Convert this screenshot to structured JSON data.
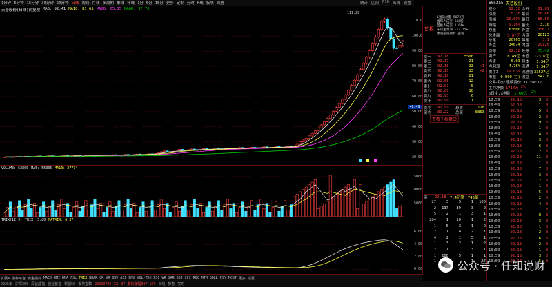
{
  "toolbar": {
    "items": [
      "1分钟",
      "5分钟",
      "15分钟",
      "30分钟",
      "60分钟",
      "日线",
      "周线",
      "月线",
      "多周期",
      "季线",
      "年线",
      "1分",
      "5分",
      "15分",
      "更多",
      "定制",
      "分时",
      "K线",
      "板块",
      "自选"
    ],
    "active_index": 5,
    "icons": [
      "统计",
      "区间",
      "F10",
      "画线",
      "设置"
    ]
  },
  "ma_header": {
    "prefix": "天普股份(日线)前复权",
    "ma5": "MA5: 92.41",
    "ma10": "MA10: 81.61",
    "ma20": "MA20: 65.15",
    "ma60": "MA60: 37.76"
  },
  "kline": {
    "axis": [
      "110.0",
      "100.0",
      "90.00",
      "80.00",
      "70.00",
      "60.00",
      "50.00",
      "40.00",
      "30.00",
      "20.00"
    ],
    "peak_label": "111.29",
    "low_label": "19.82",
    "current_tag": "48.49"
  },
  "chart_data": {
    "type": "line",
    "closes": [
      20.1,
      20.3,
      20.0,
      20.2,
      20.5,
      20.4,
      20.3,
      20.6,
      20.4,
      20.2,
      20.5,
      20.8,
      20.6,
      20.4,
      20.7,
      20.9,
      20.6,
      20.4,
      20.5,
      20.8,
      21.0,
      20.7,
      20.6,
      20.9,
      21.1,
      20.8,
      20.6,
      20.9,
      21.2,
      21.0,
      20.8,
      21.1,
      21.4,
      21.2,
      21.0,
      21.3,
      21.6,
      21.4,
      21.1,
      21.5,
      21.8,
      21.5,
      21.3,
      21.7,
      22.0,
      21.7,
      21.5,
      21.9,
      22.2,
      21.9,
      22.3,
      22.8,
      23.5,
      24.0,
      23.6,
      23.2,
      23.8,
      24.5,
      25.1,
      24.6,
      24.2,
      24.8,
      25.3,
      24.9,
      24.5,
      25.0,
      25.6,
      25.2,
      24.8,
      25.3,
      25.9,
      25.5,
      25.1,
      25.6,
      26.0,
      25.7,
      25.3,
      25.8,
      26.3,
      26.0,
      25.6,
      26.1,
      26.5,
      26.2,
      25.8,
      26.3,
      26.8,
      26.4,
      26.0,
      26.5,
      27.0,
      26.6,
      26.2,
      26.7,
      27.2,
      26.8,
      27.3,
      28.5,
      30.1,
      31.2,
      32.5,
      34.0,
      35.6,
      37.4,
      39.3,
      41.3,
      43.4,
      45.6,
      47.9,
      50.3,
      52.8,
      55.4,
      58.2,
      61.1,
      64.2,
      67.4,
      70.8,
      74.3,
      78.0,
      81.9,
      86.0,
      90.3,
      94.8,
      99.5,
      104.5,
      109.7,
      111.0,
      105.2,
      98.0,
      92.2,
      92.18,
      94.0,
      96.5
    ],
    "volume_axis": [
      "15000",
      "10000",
      "5000"
    ],
    "volume_header": {
      "title": "VOLUME: 63800",
      "ma5": "MA5: 55305",
      "ma10": "MA10: 37714"
    },
    "trix_header": {
      "title": "TRIX(12,9)",
      "trix": "TRIX: 5.80",
      "matrix": "MATRIX: 6.37"
    },
    "trix_axis": [
      "6.00",
      "4.00",
      "2.00",
      "0.00"
    ]
  },
  "quote": {
    "code": "605255",
    "name": "天普股份",
    "rows": [
      {
        "l": "现价",
        "lv": "92.18",
        "r": "今开",
        "rv": "91.81"
      },
      {
        "l": "涨跌",
        "lv": "8.38",
        "r": "最高",
        "rv": "96.46"
      },
      {
        "l": "涨幅",
        "lv": "10.00%",
        "r": "最低",
        "rv": "88.50"
      },
      {
        "l": "振幅",
        "lv": "9.16%",
        "r": "量比",
        "rv": "3.10"
      },
      {
        "l": "总量",
        "lv": "63800",
        "r": "外盘",
        "rv": "35677"
      },
      {
        "l": "总金额",
        "lv": "5.87亿",
        "r": "内盘",
        "rv": "28123"
      },
      {
        "l": "总笔",
        "lv": "20765",
        "r": "每笔",
        "rv": "3.1"
      },
      {
        "l": "外盘",
        "lv": "34674",
        "r": "内盘",
        "rv": "29126"
      },
      {
        "l": "涨停",
        "lv": "92.18",
        "r": "跌停",
        "rv": "75.42"
      },
      {
        "l": "资产",
        "lv": "8.49亿",
        "r": "市值",
        "rv": "123.6亿"
      },
      {
        "l": "净资",
        "lv": "6.03",
        "r": "股本",
        "rv": "1.34亿"
      },
      {
        "l": "净利润",
        "lv": "4.76%",
        "r": "流通",
        "rv": "1.34亿"
      },
      {
        "l": "换手Z",
        "lv": "19.03%",
        "r": "流通值",
        "rv": "33527亿"
      },
      {
        "l": "市盈",
        "lv": "0.000(亏)",
        "r": "收益",
        "rv": "547.0"
      }
    ],
    "status_line": "交易状态:连续竞价 11:04:12",
    "flow1": {
      "label": "主力净额",
      "v1": "1714万",
      "v2": "2%"
    },
    "flow2": {
      "label": "5日主力净额",
      "v1": "-1.60亿",
      "v2": "-2%"
    },
    "trades": [
      {
        "t": "10:59",
        "p": "92.18",
        "v": "3",
        "d": "B"
      },
      {
        "t": "10:59",
        "p": "92.18",
        "v": "1",
        "d": "B"
      },
      {
        "t": "10:59",
        "p": "92.18",
        "v": "5",
        "d": "B"
      },
      {
        "t": "10:59",
        "p": "92.18",
        "v": "2",
        "d": "B"
      },
      {
        "t": "10:59",
        "p": "92.18",
        "v": "9",
        "d": "B"
      },
      {
        "t": "10:59",
        "p": "92.18",
        "v": "1",
        "d": "B"
      },
      {
        "t": "10:59",
        "p": "92.18",
        "v": "4",
        "d": "B"
      },
      {
        "t": "10:59",
        "p": "92.18",
        "v": "3",
        "d": "B"
      },
      {
        "t": "10:59",
        "p": "92.18",
        "v": "6",
        "d": "B"
      },
      {
        "t": "10:59",
        "p": "92.18",
        "v": "2",
        "d": "B"
      },
      {
        "t": "10:59",
        "p": "92.18",
        "v": "11",
        "d": "B"
      },
      {
        "t": "10:59",
        "p": "92.18",
        "v": "1",
        "d": "B"
      },
      {
        "t": "10:59",
        "p": "92.18",
        "v": "7",
        "d": "B"
      },
      {
        "t": "10:59",
        "p": "92.18",
        "v": "3",
        "d": "B"
      },
      {
        "t": "10:59",
        "p": "92.18",
        "v": "2",
        "d": "B"
      },
      {
        "t": "10:59",
        "p": "92.18",
        "v": "1",
        "d": "B"
      },
      {
        "t": "10:59",
        "p": "92.18",
        "v": "5",
        "d": "B"
      },
      {
        "t": "10:59",
        "p": "92.18",
        "v": "2",
        "d": "B"
      },
      {
        "t": "10:59",
        "p": "92.18",
        "v": "4",
        "d": "B"
      },
      {
        "t": "10:59",
        "p": "92.18",
        "v": "1",
        "d": "B"
      },
      {
        "t": "10:59",
        "p": "92.18",
        "v": "8",
        "d": "B"
      },
      {
        "t": "10:59",
        "p": "92.18",
        "v": "3",
        "d": "B"
      },
      {
        "t": "10:59",
        "p": "92.18",
        "v": "1",
        "d": "B"
      },
      {
        "t": "10:59",
        "p": "92.18",
        "v": "2",
        "d": "B"
      },
      {
        "t": "10:59",
        "p": "92.18",
        "v": "6",
        "d": "B"
      },
      {
        "t": "10:59",
        "p": "92.18",
        "v": "2",
        "d": "B"
      },
      {
        "t": "10:59",
        "p": "92.18",
        "v": "1",
        "d": "B"
      },
      {
        "t": "10:59",
        "p": "92.18",
        "v": "3",
        "d": "B"
      },
      {
        "t": "10:59",
        "p": "92.18",
        "v": "5",
        "d": "B"
      }
    ]
  },
  "mid": {
    "tag": "首板",
    "stats": [
      "1当前总量 5073万",
      "当年人成交 606股",
      "首板人成交 1.64%",
      "十日主力净 -17.15%",
      "建设投资题材 查看"
    ],
    "orders": [
      {
        "l": "卖一",
        "p": "92.18",
        "v": "5506",
        "c": ""
      },
      {
        "l": "卖二",
        "p": "92.17",
        "v": "21",
        "c": "+"
      },
      {
        "l": "卖三",
        "p": "92.16",
        "v": "13",
        "c": "+1"
      },
      {
        "l": "卖四",
        "p": "92.15",
        "v": "13",
        "c": "+2"
      },
      {
        "l": "卖五",
        "p": "92.10",
        "v": "21",
        "c": ""
      },
      {
        "l": "卖六",
        "p": "92.05",
        "v": "12",
        "c": ""
      },
      {
        "l": "卖七",
        "p": "92.01",
        "v": "5",
        "c": ""
      },
      {
        "l": "卖八",
        "p": "92.00",
        "v": "10",
        "c": ""
      },
      {
        "l": "卖九",
        "p": "91.93",
        "v": "6",
        "c": ""
      },
      {
        "l": "卖十",
        "p": "91.90",
        "v": "1",
        "c": ""
      }
    ],
    "sum1": {
      "l": "卖均",
      "v": "91.99",
      "r": "总卖",
      "rv": "128"
    },
    "sum2": {
      "l": "买均",
      "v": "89.22",
      "r": "总买",
      "rv": "8863"
    },
    "link": "查看千档盘口",
    "bid_header": {
      "l": "买一",
      "p": "92.18",
      "v": "7.4亿笔",
      "c": "743笔"
    },
    "bid_grid": [
      [
        "27",
        "3",
        "5",
        "1",
        "100"
      ],
      [
        "2",
        "137",
        "39",
        "3",
        "2"
      ],
      [
        "5",
        "2",
        "1",
        "3",
        "1"
      ],
      [
        "284",
        "1",
        "10",
        "1",
        "2"
      ],
      [
        "1",
        "5",
        "3",
        "1",
        "2"
      ],
      [
        "2",
        "1",
        "4",
        "2",
        "1"
      ],
      [
        "4",
        "2",
        "1",
        "5",
        "1"
      ],
      [
        "1",
        "3",
        "2",
        "1",
        "2"
      ],
      [
        "2",
        "1",
        "1",
        "3",
        "1"
      ],
      [
        "1",
        "100",
        "5",
        "1",
        "1"
      ],
      [
        "1",
        "1",
        "",
        "1",
        "27"
      ]
    ]
  },
  "indicator_tabs": [
    "扩展A",
    "指标平台",
    "资金指标",
    "MACD",
    "DMI",
    "DMA",
    "FSL",
    "TRIX",
    "BRAR",
    "CR",
    "VR",
    "OBV",
    "ASI",
    "EMV",
    "VOL-TDX",
    "RSI",
    "WR",
    "SAR",
    "KDJ",
    "CCI",
    "ROC",
    "MTM",
    "BOLL",
    "PSY",
    "MCST",
    "更多",
    "设置"
  ],
  "indicator_active": 7,
  "status_bar": {
    "left": "2025年",
    "items": [
      "沪深300",
      "深证成指",
      "创业板指",
      "科创50",
      "板块指数"
    ],
    "middle": "20250702(三) 37 量价涨幅337.15%",
    "right": [
      "日线",
      "静态",
      "实时"
    ]
  },
  "watermark": "公众号 · 任知说财"
}
